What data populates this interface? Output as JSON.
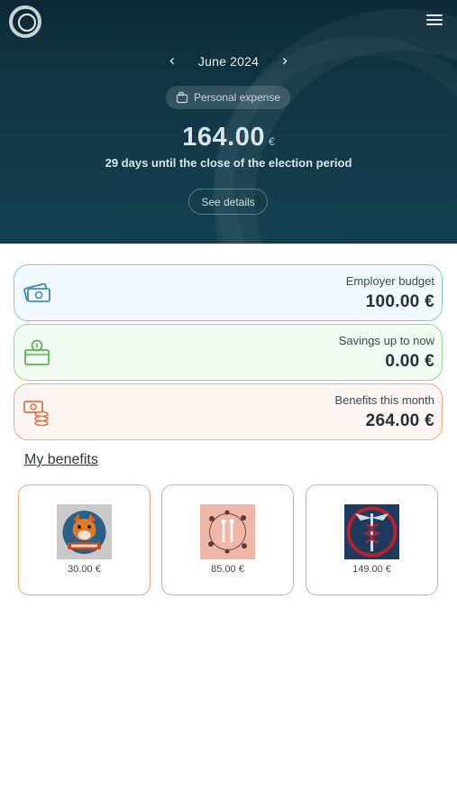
{
  "header": {
    "month": "June 2024",
    "chip_label": "Personal expense",
    "amount": "164.00",
    "currency": "€",
    "countdown": "29 days until the close of the election period",
    "details_button": "See details"
  },
  "cards": [
    {
      "label": "Employer budget",
      "value": "100.00 €",
      "icon": "banknotes-icon"
    },
    {
      "label": "Savings up to now",
      "value": "0.00 €",
      "icon": "piggy-box-icon"
    },
    {
      "label": "Benefits this month",
      "value": "264.00 €",
      "icon": "money-coins-icon"
    }
  ],
  "my_benefits": {
    "title": "My benefits",
    "items": [
      {
        "price": "30.00 €",
        "image": "fox-badge-image"
      },
      {
        "price": "85.00 €",
        "image": "floral-wedding-image"
      },
      {
        "price": "149.00 €",
        "image": "caduceus-medical-image"
      }
    ]
  },
  "colors": {
    "header_bg": "#123846",
    "budget_border": "#8cc4dc",
    "savings_border": "#96d88e",
    "benefits_border": "#f2a887"
  }
}
